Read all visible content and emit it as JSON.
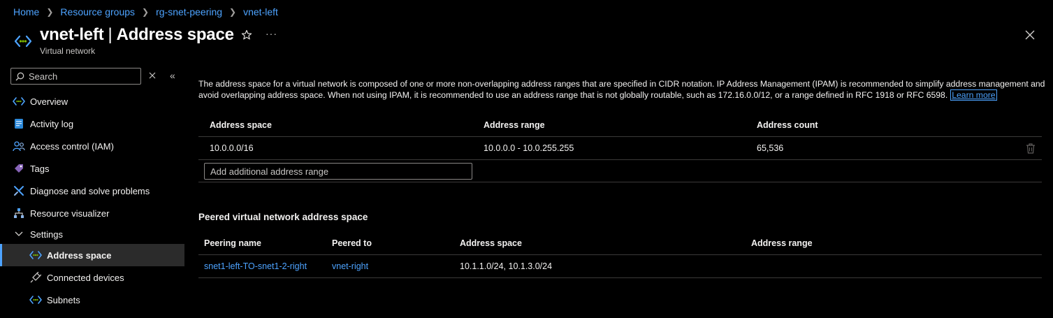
{
  "breadcrumb": [
    "Home",
    "Resource groups",
    "rg-snet-peering",
    "vnet-left"
  ],
  "header": {
    "resource_name": "vnet-left",
    "section": "Address space",
    "separator": "|",
    "subtitle": "Virtual network",
    "more": "···"
  },
  "sidebar": {
    "search_placeholder": "Search",
    "collapse": "«",
    "items": [
      {
        "label": "Overview",
        "icon": "vnet-icon"
      },
      {
        "label": "Activity log",
        "icon": "activity-log-icon"
      },
      {
        "label": "Access control (IAM)",
        "icon": "people-icon"
      },
      {
        "label": "Tags",
        "icon": "tag-icon"
      },
      {
        "label": "Diagnose and solve problems",
        "icon": "wrench-icon"
      },
      {
        "label": "Resource visualizer",
        "icon": "hierarchy-icon"
      },
      {
        "label": "Settings",
        "icon": "chevron-down-icon"
      },
      {
        "label": "Address space",
        "icon": "vnet-icon",
        "active": true
      },
      {
        "label": "Connected devices",
        "icon": "plug-icon"
      },
      {
        "label": "Subnets",
        "icon": "vnet-icon"
      }
    ]
  },
  "main": {
    "description": "The address space for a virtual network is composed of one or more non-overlapping address ranges that are specified in CIDR notation. IP Address Management (IPAM) is recommended to simplify address management and avoid overlapping address space. When not using IPAM, it is recommended to use an address range that is not globally routable, such as 172.16.0.0/12, or a range defined in RFC 1918 or RFC 6598.",
    "learn_more": "Learn more",
    "address_table": {
      "headers": [
        "Address space",
        "Address range",
        "Address count"
      ],
      "rows": [
        {
          "space": "10.0.0.0/16",
          "range": "10.0.0.0 - 10.0.255.255",
          "count": "65,536"
        }
      ],
      "add_placeholder": "Add additional address range"
    },
    "peered_title": "Peered virtual network address space",
    "peered_table": {
      "headers": [
        "Peering name",
        "Peered to",
        "Address space",
        "Address range"
      ],
      "rows": [
        {
          "peering_name": "snet1-left-TO-snet1-2-right",
          "peered_to": "vnet-right",
          "address_space": "10.1.1.0/24, 10.1.3.0/24",
          "address_range": ""
        }
      ]
    }
  },
  "colors": {
    "background": "#000000",
    "link": "#4da3ff",
    "active_item_bg": "#2b2b2b",
    "divider": "#3b3a39"
  }
}
